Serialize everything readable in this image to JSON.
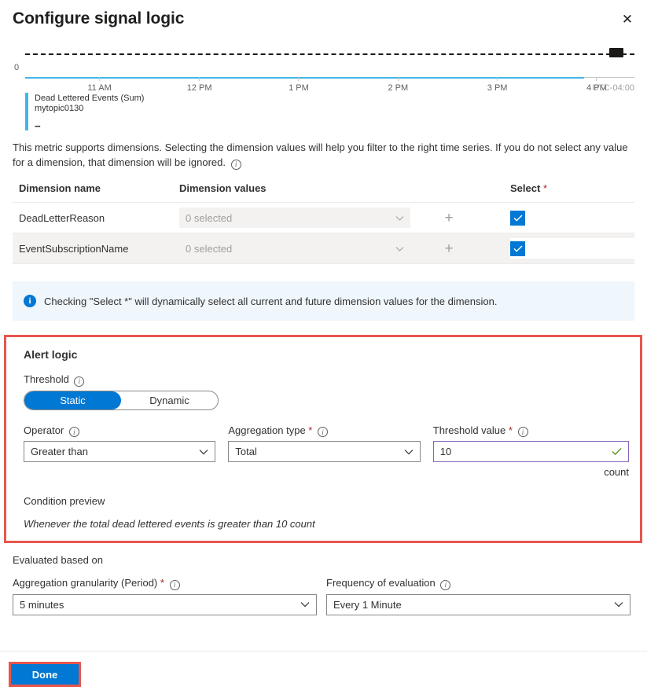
{
  "header": {
    "title": "Configure signal logic",
    "close_label": "✕"
  },
  "chart": {
    "legend_metric": "Dead Lettered Events (Sum)",
    "legend_resource": "mytopic0130",
    "legend_value": "--",
    "y_zero": "0",
    "timezone": "UTC-04:00",
    "series_color": "#41b7e8",
    "threshold_line_color": "#1b1a19"
  },
  "chart_data": {
    "type": "line",
    "title": "Dead Lettered Events (Sum)",
    "subtitle": "mytopic0130",
    "xlabel": "",
    "ylabel": "",
    "x_tick_labels": [
      "11 AM",
      "12 PM",
      "1 PM",
      "2 PM",
      "3 PM",
      "4 PM"
    ],
    "x_tick_positions_pct": [
      12.2,
      28.6,
      44.9,
      61.2,
      77.5,
      93.8
    ],
    "y_tick_labels": [
      "0"
    ],
    "ylim": [
      0,
      10
    ],
    "series": [
      {
        "name": "Dead Lettered Events (Sum)",
        "resource": "mytopic0130",
        "color": "#41b7e8",
        "values": [
          0,
          0,
          0,
          0,
          0,
          0
        ],
        "display_value": "--"
      }
    ],
    "annotations": [
      {
        "type": "threshold-line",
        "value": 10,
        "style": "dashed",
        "color": "#1b1a19"
      },
      {
        "type": "marker",
        "label": "",
        "color": "#1b1a19",
        "position": "top-right"
      }
    ],
    "grid": false,
    "legend_position": "bottom-left",
    "timezone": "UTC-04:00"
  },
  "dimensions_description": "This metric supports dimensions. Selecting the dimension values will help you filter to the right time series. If you do not select any value for a dimension, that dimension will be ignored.",
  "dimension_table": {
    "columns": {
      "name": "Dimension name",
      "values": "Dimension values",
      "select": "Select",
      "select_required_marker": "*"
    },
    "rows": [
      {
        "name": "DeadLetterReason",
        "values_placeholder": "0 selected",
        "add_label": "+",
        "selected": true
      },
      {
        "name": "EventSubscriptionName",
        "values_placeholder": "0 selected",
        "add_label": "+",
        "selected": true
      }
    ]
  },
  "banner": {
    "icon": "info-icon",
    "text": "Checking \"Select *\" will dynamically select all current and future dimension values for the dimension."
  },
  "alert_logic": {
    "section_title": "Alert logic",
    "highlight_color": "#e8554c",
    "threshold": {
      "label": "Threshold",
      "options": [
        "Static",
        "Dynamic"
      ],
      "selected": "Static"
    },
    "operator": {
      "label": "Operator",
      "value": "Greater than"
    },
    "aggregation_type": {
      "label": "Aggregation type",
      "required_marker": "*",
      "value": "Total"
    },
    "threshold_value": {
      "label": "Threshold value",
      "required_marker": "*",
      "value": "10",
      "unit": "count",
      "valid": true
    },
    "condition_preview": {
      "label": "Condition preview",
      "text": "Whenever the total dead lettered events is greater than 10 count"
    }
  },
  "evaluated_based_on": {
    "section_title": "Evaluated based on",
    "granularity": {
      "label": "Aggregation granularity (Period)",
      "required_marker": "*",
      "value": "5 minutes"
    },
    "frequency": {
      "label": "Frequency of evaluation",
      "value": "Every 1 Minute"
    }
  },
  "footer": {
    "done_label": "Done",
    "done_color": "#0078d4",
    "highlight_color": "#e8554c"
  }
}
